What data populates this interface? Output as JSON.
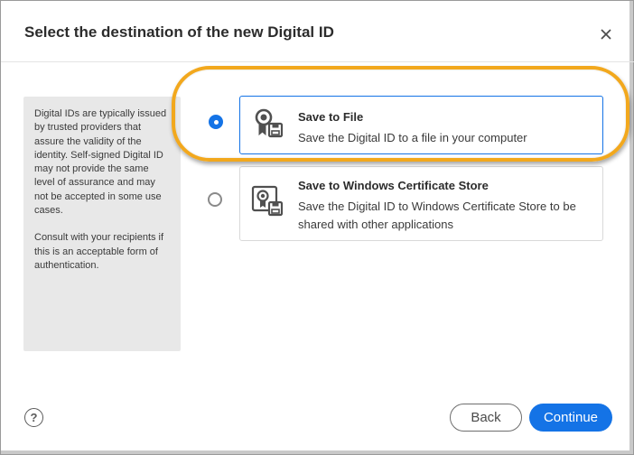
{
  "dialog": {
    "title": "Select the destination of the new Digital ID",
    "close_icon": "close-icon"
  },
  "info_panel": {
    "paragraph1": "Digital IDs are typically issued by trusted providers that assure the validity of the identity. Self-signed Digital ID may not provide the same level of assurance and may not be accepted in some use cases.",
    "paragraph2": "Consult with your recipients if this is an acceptable form of authentication."
  },
  "options": [
    {
      "title": "Save to File",
      "description": "Save the Digital ID to a file in your computer",
      "selected": true,
      "icon": "certificate-file-icon"
    },
    {
      "title": "Save to Windows Certificate Store",
      "description": "Save the Digital ID to Windows Certificate Store to be shared with other applications",
      "selected": false,
      "icon": "certificate-store-icon"
    }
  ],
  "footer": {
    "help_label": "?",
    "back_label": "Back",
    "continue_label": "Continue"
  },
  "colors": {
    "accent": "#1473e6",
    "highlight": "#f2a81d",
    "panel_bg": "#e8e8e8"
  }
}
